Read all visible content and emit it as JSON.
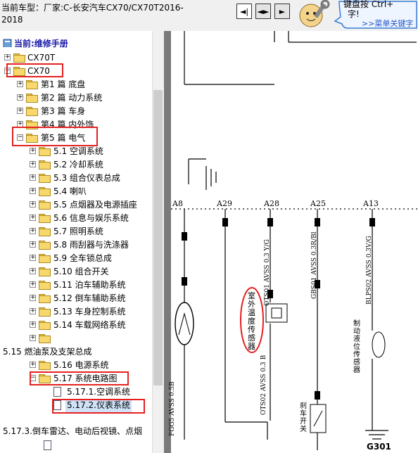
{
  "header": {
    "vehicle_label": "当前车型：厂家:C-长安汽车CX70/CX70T2016-2018",
    "nav_buttons": [
      "◄|",
      "◄►",
      "►"
    ],
    "tip_line1": "键盘按 Ctrl+",
    "tip_line2": "字!",
    "tip_link": ">>菜单关键字"
  },
  "sidebar": {
    "root_label": "当前:维修手册",
    "models": [
      "CX70T",
      "CX70"
    ],
    "chapters": [
      "第1 篇 底盘",
      "第2 篇 动力系统",
      "第3 篇 车身",
      "第4 篇 内外饰",
      "第5 篇 电气"
    ],
    "sections": [
      "5.1 空调系统",
      "5.2 冷却系统",
      "5.3 组合仪表总成",
      "5.4 喇叭",
      "5.5 点烟器及电源插座",
      "5.6 信息与娱乐系统",
      "5.7 照明系统",
      "5.8 雨刮器与洗涤器",
      "5.9 全车锁总成",
      "5.10 组合开关",
      "5.11 泊车辅助系统",
      "5.12 倒车辅助系统",
      "5.13 车身控制系统",
      "5.14 车载网络系统"
    ],
    "floating_item": "5.15 燃油泵及支架总成",
    "more_sections": [
      "5.16 电源系统",
      "5.17 系统电路图"
    ],
    "docs": [
      "5.17.1.空调系统",
      "5.17.2.仪表系统"
    ],
    "bottom_item": "5.17.3.倒车雷达、电动后视镜、点烟"
  },
  "diagram": {
    "pins": [
      "A8",
      "A29",
      "A28",
      "A25",
      "A13"
    ],
    "wire_labels": [
      "FGG5 AVSS 0.5B",
      "OTS01 AVSS 0.3 Y/G",
      "OTS02 AVSS 0.3 B",
      "GBS01 AVSS 0.3R/Bl",
      "BLPS02 AVSS 0.3V/G"
    ],
    "component_labels": [
      "室外温度传感器",
      "制动液位传感器",
      "刹车开关"
    ],
    "ground_label": "G301",
    "colors": {
      "annotation_red": "#e52020",
      "selection_blue": "#cfe2f7",
      "folder_yellow": "#f7d86c",
      "link_blue": "#2255cc"
    }
  }
}
